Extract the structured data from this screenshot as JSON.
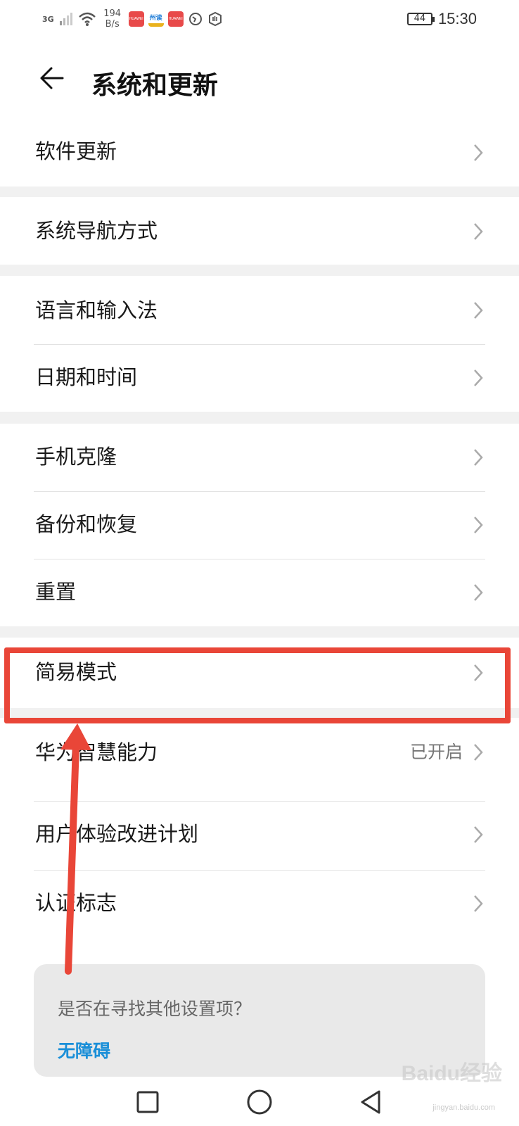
{
  "status_bar": {
    "network": "3G",
    "speed_value": "194",
    "speed_unit": "B/s",
    "app_badges": [
      "HUAWEI",
      "州读",
      "HUAWEI"
    ],
    "battery": "44",
    "time": "15:30"
  },
  "header": {
    "title": "系统和更新"
  },
  "items": {
    "software_update": "软件更新",
    "nav_mode": "系统导航方式",
    "language": "语言和输入法",
    "date_time": "日期和时间",
    "phone_clone": "手机克隆",
    "backup": "备份和恢复",
    "reset": "重置",
    "simple_mode": "简易模式",
    "huawei_ai": "华为智慧能力",
    "huawei_ai_status": "已开启",
    "ux_program": "用户体验改进计划",
    "certification": "认证标志"
  },
  "hint": {
    "question": "是否在寻找其他设置项？",
    "link": "无障碍"
  },
  "watermark": {
    "main": "Baidu经验",
    "sub": "jingyan.baidu.com"
  },
  "colors": {
    "accent_link": "#1a8fd8",
    "annotation": "#e94638"
  }
}
